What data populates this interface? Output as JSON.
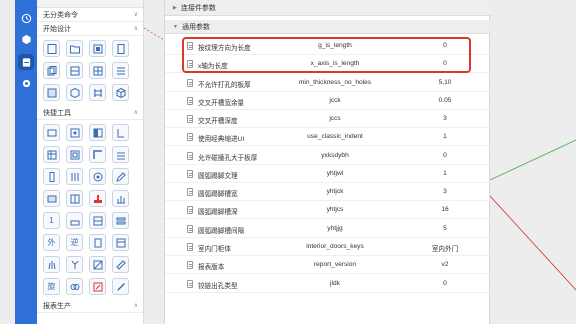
{
  "panel": {
    "sections": [
      {
        "label": "无分类命令"
      },
      {
        "label": "开始设计"
      },
      {
        "label": "快捷工具"
      },
      {
        "label": "报表生产"
      }
    ],
    "text_icons": {
      "outer": "外",
      "reverse": "逆",
      "rotate": "旋",
      "one": "1"
    }
  },
  "dialog": {
    "group_collapsed": "连接件参数",
    "group_expanded": "通用参数",
    "rows": [
      {
        "name": "按纹理方向为长度",
        "key": "g_is_length",
        "value": "0"
      },
      {
        "name": "x轴为长度",
        "key": "x_axis_is_length",
        "value": "0"
      },
      {
        "name": "不允许打孔的板厚",
        "key": "min_thickness_no_holes",
        "value": "5,10"
      },
      {
        "name": "交叉开槽宽余量",
        "key": "jcck",
        "value": "0.05"
      },
      {
        "name": "交叉开槽深度",
        "key": "jccs",
        "value": "3"
      },
      {
        "name": "使用经典缩进UI",
        "key": "use_classic_indent",
        "value": "1"
      },
      {
        "name": "允许碰撞孔大于板厚",
        "key": "yxksdybh",
        "value": "0"
      },
      {
        "name": "圆弧踢脚文理",
        "key": "yhtjwl",
        "value": "1"
      },
      {
        "name": "圆弧踢脚槽宽",
        "key": "yhtjck",
        "value": "3"
      },
      {
        "name": "圆弧踢脚槽深",
        "key": "yhtjcs",
        "value": "16"
      },
      {
        "name": "圆弧踢脚槽间隔",
        "key": "yhtjjg",
        "value": "5"
      },
      {
        "name": "室内门柜体",
        "key": "interior_doors_keys",
        "value": "室内外门"
      },
      {
        "name": "报表版本",
        "key": "report_version",
        "value": "v2"
      },
      {
        "name": "铰链出孔类型",
        "key": "jldk",
        "value": "0"
      }
    ]
  },
  "colors": {
    "accent": "#2e70d6",
    "highlight": "#e0352b"
  }
}
